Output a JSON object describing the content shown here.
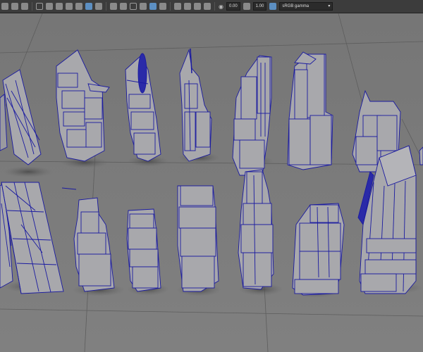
{
  "toolbar": {
    "exposure_value": "0.00",
    "gamma_value": "1.00",
    "color_space": "sRGB gamma",
    "combo_arrow": "▾",
    "icons": [
      "select-icon",
      "lasso-icon",
      "paint-icon",
      "move-icon",
      "rotate-icon",
      "scale-icon",
      "camera-icon",
      "grid-icon",
      "wireframe-icon",
      "shaded-icon",
      "textured-icon",
      "lights-icon",
      "shadows-icon",
      "ao-icon",
      "isolate-icon",
      "xray-icon",
      "exposure-icon",
      "gamma-icon"
    ]
  },
  "viewport": {
    "background": "#7c7c7c",
    "wire_color": "#1a1aa0",
    "mesh_color": "#a8a8ac",
    "model_count": 15
  }
}
